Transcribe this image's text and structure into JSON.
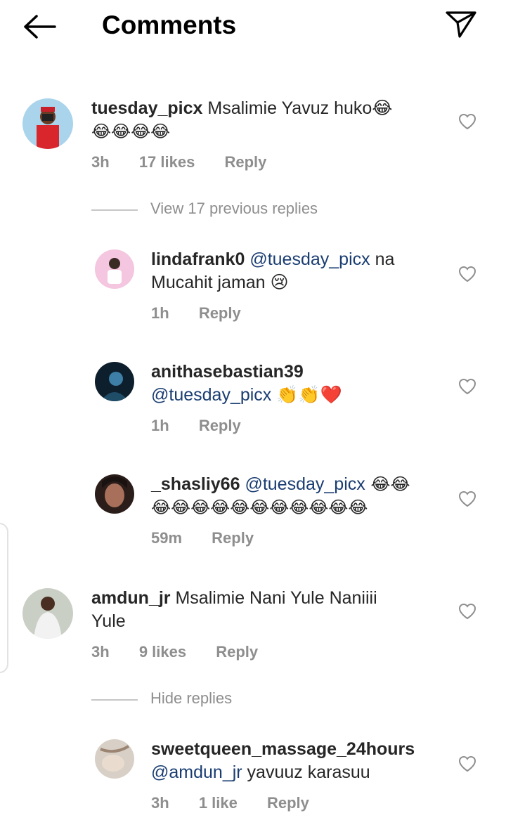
{
  "header": {
    "title": "Comments",
    "back_icon": "arrow-left-icon",
    "send_icon": "paper-plane-icon"
  },
  "comments": [
    {
      "username": "tuesday_picx",
      "text": "Msalimie Yavuz huko😂",
      "text2": "😂😂😂😂",
      "time": "3h",
      "likes": "17 likes",
      "reply": "Reply",
      "toggle": "View 17 previous replies",
      "replies": [
        {
          "username": "lindafrank0",
          "mention": "@tuesday_picx",
          "text": " na",
          "text2": "Mucahit jaman 😢",
          "time": "1h",
          "reply": "Reply"
        },
        {
          "username": "anithasebastian39",
          "mention": "@tuesday_picx",
          "text": " 👏👏❤️",
          "time": "1h",
          "reply": "Reply"
        },
        {
          "username": "_shasliy66",
          "mention": "@tuesday_picx",
          "text": " 😂😂",
          "text2": "😂😂😂😂😂😂😂😂😂😂😂",
          "time": "59m",
          "reply": "Reply"
        }
      ]
    },
    {
      "username": "amdun_jr",
      "text": "Msalimie Nani Yule Naniiii",
      "text2": "Yule",
      "time": "3h",
      "likes": "9 likes",
      "reply": "Reply",
      "toggle": "Hide replies",
      "replies": [
        {
          "username": "sweetqueen_massage_24hours",
          "mention": "@amdun_jr",
          "text": " yavuuz karasuu",
          "time": "3h",
          "likes": "1 like",
          "reply": "Reply"
        }
      ]
    }
  ],
  "colors": {
    "mention": "#1a3d72",
    "meta": "#8e8e8e",
    "text": "#262626"
  }
}
